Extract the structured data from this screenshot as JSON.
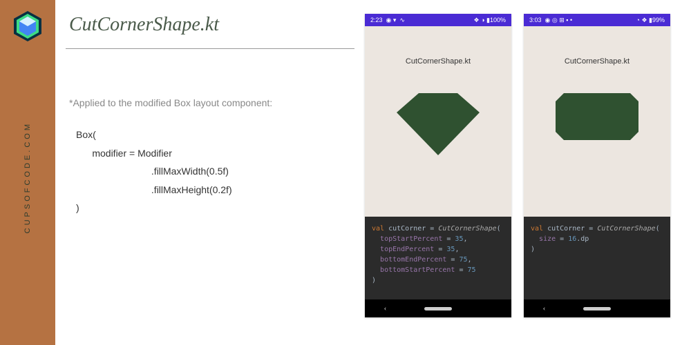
{
  "sidebar": {
    "brand": "CUPSOFCODE.COM"
  },
  "page": {
    "title": "CutCornerShape.kt",
    "note": "*Applied to the modified Box layout component:",
    "code": "Box(\n      modifier = Modifier\n                            .fillMaxWidth(0.5f)\n                            .fillMaxHeight(0.2f)\n)"
  },
  "phones": [
    {
      "time": "2:23",
      "statusRight": "100%",
      "title": "CutCornerShape.kt",
      "code": {
        "decl": "val",
        "name": "cutCorner",
        "fn": "CutCornerShape",
        "lines": [
          {
            "prop": "topStartPercent",
            "val": "35"
          },
          {
            "prop": "topEndPercent",
            "val": "35"
          },
          {
            "prop": "bottomEndPercent",
            "val": "75"
          },
          {
            "prop": "bottomStartPercent",
            "val": "75"
          }
        ]
      }
    },
    {
      "time": "3:03",
      "statusRight": "99%",
      "title": "CutCornerShape.kt",
      "code": {
        "decl": "val",
        "name": "cutCorner",
        "fn": "CutCornerShape",
        "lines": [
          {
            "prop": "size",
            "val": "16",
            "suffix": ".dp"
          }
        ]
      }
    }
  ]
}
